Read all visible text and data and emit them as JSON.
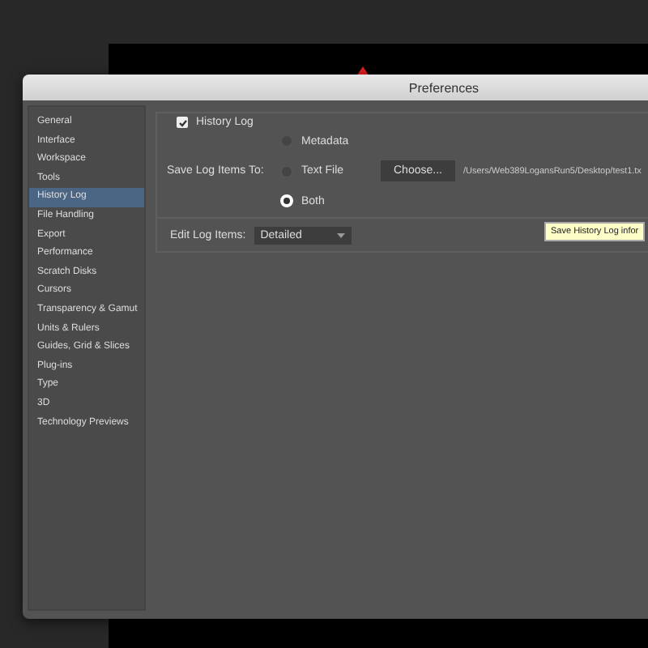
{
  "window": {
    "title": "Preferences"
  },
  "sidebar": {
    "items": [
      {
        "label": "General",
        "selected": false
      },
      {
        "label": "Interface",
        "selected": false
      },
      {
        "label": "Workspace",
        "selected": false
      },
      {
        "label": "Tools",
        "selected": false
      },
      {
        "label": "History Log",
        "selected": true
      },
      {
        "label": "File Handling",
        "selected": false
      },
      {
        "label": "Export",
        "selected": false
      },
      {
        "label": "Performance",
        "selected": false
      },
      {
        "label": "Scratch Disks",
        "selected": false
      },
      {
        "label": "Cursors",
        "selected": false
      },
      {
        "label": "Transparency & Gamut",
        "selected": false
      },
      {
        "label": "Units & Rulers",
        "selected": false
      },
      {
        "label": "Guides, Grid & Slices",
        "selected": false
      },
      {
        "label": "Plug-ins",
        "selected": false
      },
      {
        "label": "Type",
        "selected": false
      },
      {
        "label": "3D",
        "selected": false
      },
      {
        "label": "Technology Previews",
        "selected": false
      }
    ]
  },
  "history_log": {
    "label": "History Log",
    "checked": true
  },
  "save_log": {
    "label": "Save Log Items To:",
    "options": [
      {
        "label": "Metadata",
        "selected": false
      },
      {
        "label": "Text File",
        "selected": false
      },
      {
        "label": "Both",
        "selected": true
      }
    ],
    "choose_button": "Choose...",
    "path": "/Users/Web389LogansRun5/Desktop/test1.tx"
  },
  "edit_log": {
    "label": "Edit Log Items:",
    "value": "Detailed"
  },
  "tooltip": "Save History Log infor"
}
